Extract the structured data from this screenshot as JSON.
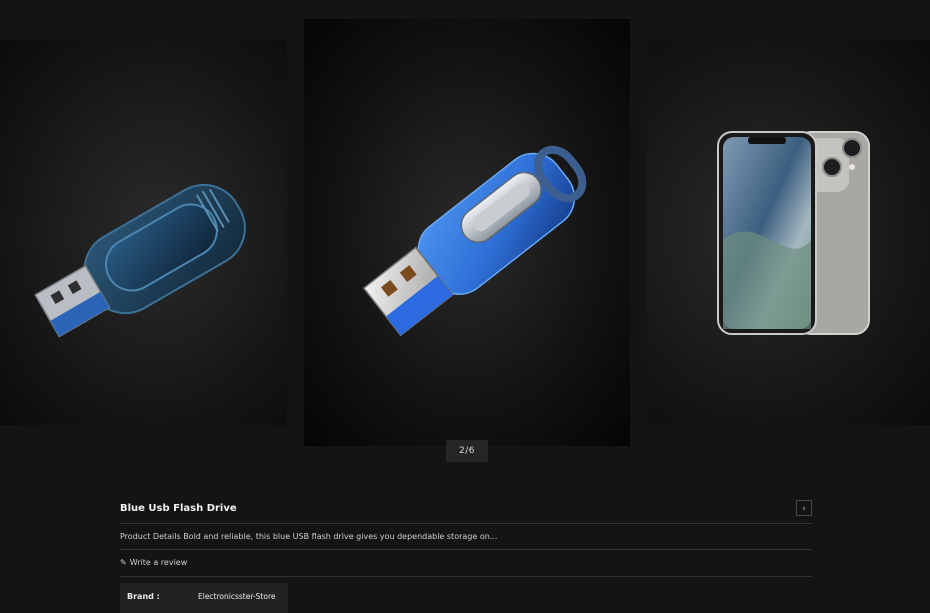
{
  "carousel": {
    "counter": "2/6",
    "slides": [
      {
        "name": "blue-usb-drive-side",
        "position": "previous"
      },
      {
        "name": "blue-usb-flash-drive",
        "position": "current"
      },
      {
        "name": "smartphone",
        "position": "next"
      }
    ]
  },
  "product": {
    "title": "Blue Usb Flash Drive",
    "next_icon": "chevron-right-icon",
    "next_glyph": "›",
    "description": "Product Details Bold and reliable, this blue USB flash drive gives you dependable storage on...",
    "review_icon": "pencil-icon",
    "review_glyph": "✎",
    "review_link": "Write a review",
    "attributes": [
      {
        "label": "Brand :",
        "value": "Electronicsster-Store"
      }
    ]
  },
  "colors": {
    "background": "#141414",
    "usb_blue": "#2f6fd8",
    "usb_dark_blue": "#1e3e5c"
  }
}
